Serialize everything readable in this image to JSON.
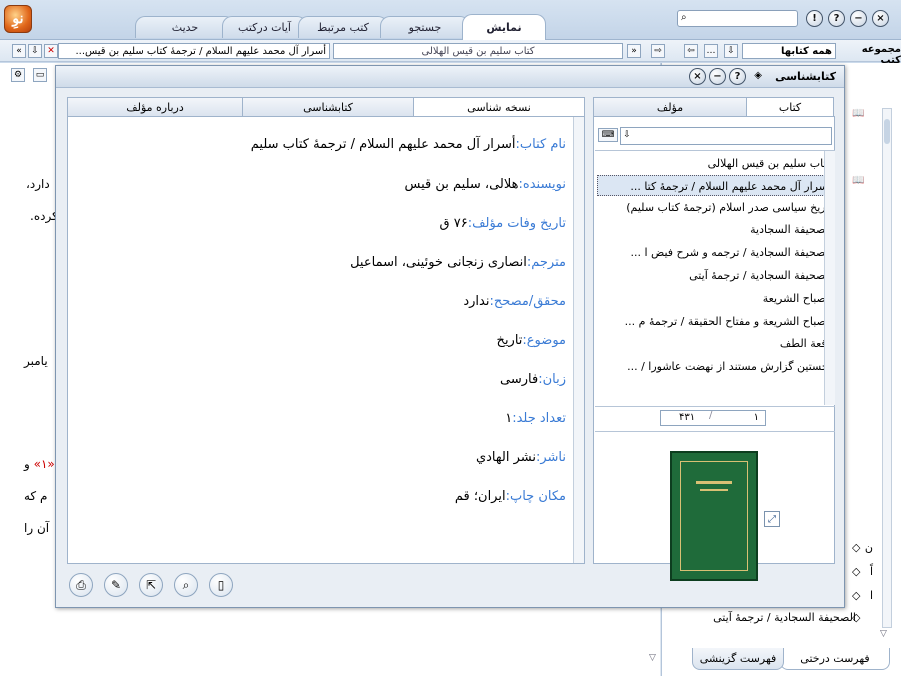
{
  "app": {
    "logo_text": "نوِ",
    "tabs": [
      "نمایش",
      "جستجو",
      "کتب مرتبط",
      "آیات درکتب",
      "حدیث"
    ],
    "search_glass": "🔍",
    "window_buttons": [
      "!",
      "?",
      "−",
      "×"
    ]
  },
  "address_bar": {
    "title_text": "أسرار آل محمد علیهم السلام / ترجمهٔ کتاب سلیم بن قیس...",
    "secondary_text": "کتاب سلیم بن قیس الهلالی",
    "collection_label": "مجموعه کتب",
    "collection_value": "همه کتابها"
  },
  "background": {
    "left_text_1": "دارد،",
    "left_text_2": "کرده.",
    "left_text_3": "یامبر",
    "left_text_4": "و",
    "left_text_4_mark": "«١»",
    "left_text_5": "م که",
    "left_text_6": "آن را",
    "tree_items": [
      "ن",
      "اً",
      "ا",
      "الصحیفة السجادیة / ترجمهٔ آیتی"
    ],
    "bottom_tabs": [
      "فهرست درختی",
      "فهرست گزینشی"
    ]
  },
  "dialog": {
    "title": "کتابشناسی",
    "left_tabs": [
      "کتاب",
      "مؤلف"
    ],
    "right_tabs": [
      "نسخه شناسی",
      "کتابشناسی",
      "درباره مؤلف"
    ],
    "details": [
      {
        "label": "نام کتاب:",
        "value": "أسرار آل محمد علیهم السلام / ترجمهٔ کتاب سلیم"
      },
      {
        "label": "نویسنده:",
        "value": "هلالی، سلیم بن قیس"
      },
      {
        "label": "تاریخ وفات مؤلف:",
        "value": "۷۶ ق"
      },
      {
        "label": "مترجم:",
        "value": "انصاری زنجانی خوئینی، اسماعیل"
      },
      {
        "label": "محقق/مصحح:",
        "value": "ندارد"
      },
      {
        "label": "موضوع:",
        "value": "تاریخ"
      },
      {
        "label": "زبان:",
        "value": "فارسی"
      },
      {
        "label": "تعداد جلد:",
        "value": "۱"
      },
      {
        "label": "ناشر:",
        "value": "نشر الهادي"
      },
      {
        "label": "مکان چاپ:",
        "value": "ایران؛ قم"
      }
    ],
    "book_list": [
      "کتاب سلیم بن قیس الهلالی",
      "أسرار آل محمد علیهم السلام / ترجمهٔ کتا ...",
      "تاریخ سیاسی صدر اسلام (ترجمهٔ کتاب سلیم)",
      "الصحیفة السجادیة",
      "الصحیفة السجادیة / ترجمه و شرح فیض ا ...",
      "الصحیفة السجادیة / ترجمهٔ آیتی",
      "مصباح الشریعة",
      "مصباح الشریعة و مفتاح الحقیقة / ترجمهٔ م ...",
      "وقعة الطف",
      "نخستین گزارش مستند از نهضت عاشورا / ..."
    ],
    "pager": {
      "current": "۱",
      "total": "۴۳۱"
    },
    "bottom_buttons": [
      "print-icon",
      "edit-icon",
      "export-icon",
      "zoom-icon",
      "page-icon"
    ]
  }
}
